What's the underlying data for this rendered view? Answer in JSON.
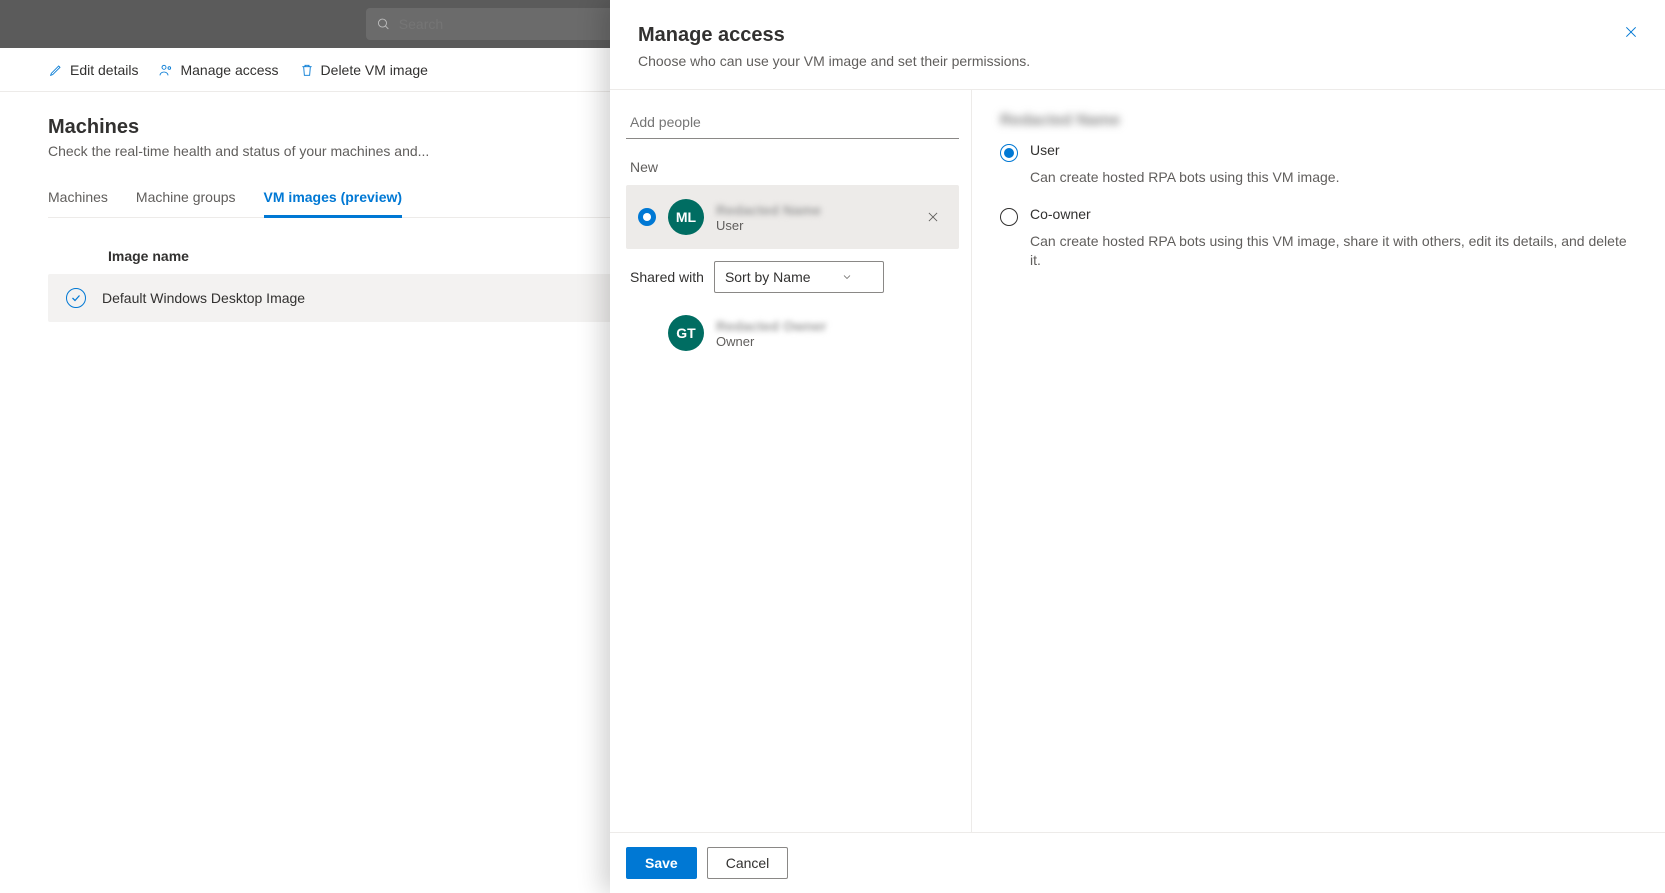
{
  "search": {
    "placeholder": "Search"
  },
  "toolbar": {
    "edit": "Edit details",
    "manage": "Manage access",
    "delete": "Delete VM image"
  },
  "page": {
    "title": "Machines",
    "subtitle": "Check the real-time health and status of your machines and..."
  },
  "tabs": {
    "machines": "Machines",
    "machine_groups": "Machine groups",
    "vm_images": "VM images (preview)"
  },
  "table": {
    "header": "Image name",
    "row0": "Default Windows Desktop Image"
  },
  "panel": {
    "title": "Manage access",
    "subtitle": "Choose who can use your VM image and set their permissions.",
    "add_people_placeholder": "Add people",
    "new_label": "New",
    "shared_with_label": "Shared with",
    "sort_label": "Sort by Name",
    "save": "Save",
    "cancel": "Cancel"
  },
  "people": {
    "new0": {
      "initials": "ML",
      "name": "Redacted Name",
      "role": "User"
    },
    "shared0": {
      "initials": "GT",
      "name": "Redacted Owner",
      "role": "Owner"
    }
  },
  "perms": {
    "selected_name": "Redacted Name",
    "user_label": "User",
    "user_desc": "Can create hosted RPA bots using this VM image.",
    "coowner_label": "Co-owner",
    "coowner_desc": "Can create hosted RPA bots using this VM image, share it with others, edit its details, and delete it."
  }
}
